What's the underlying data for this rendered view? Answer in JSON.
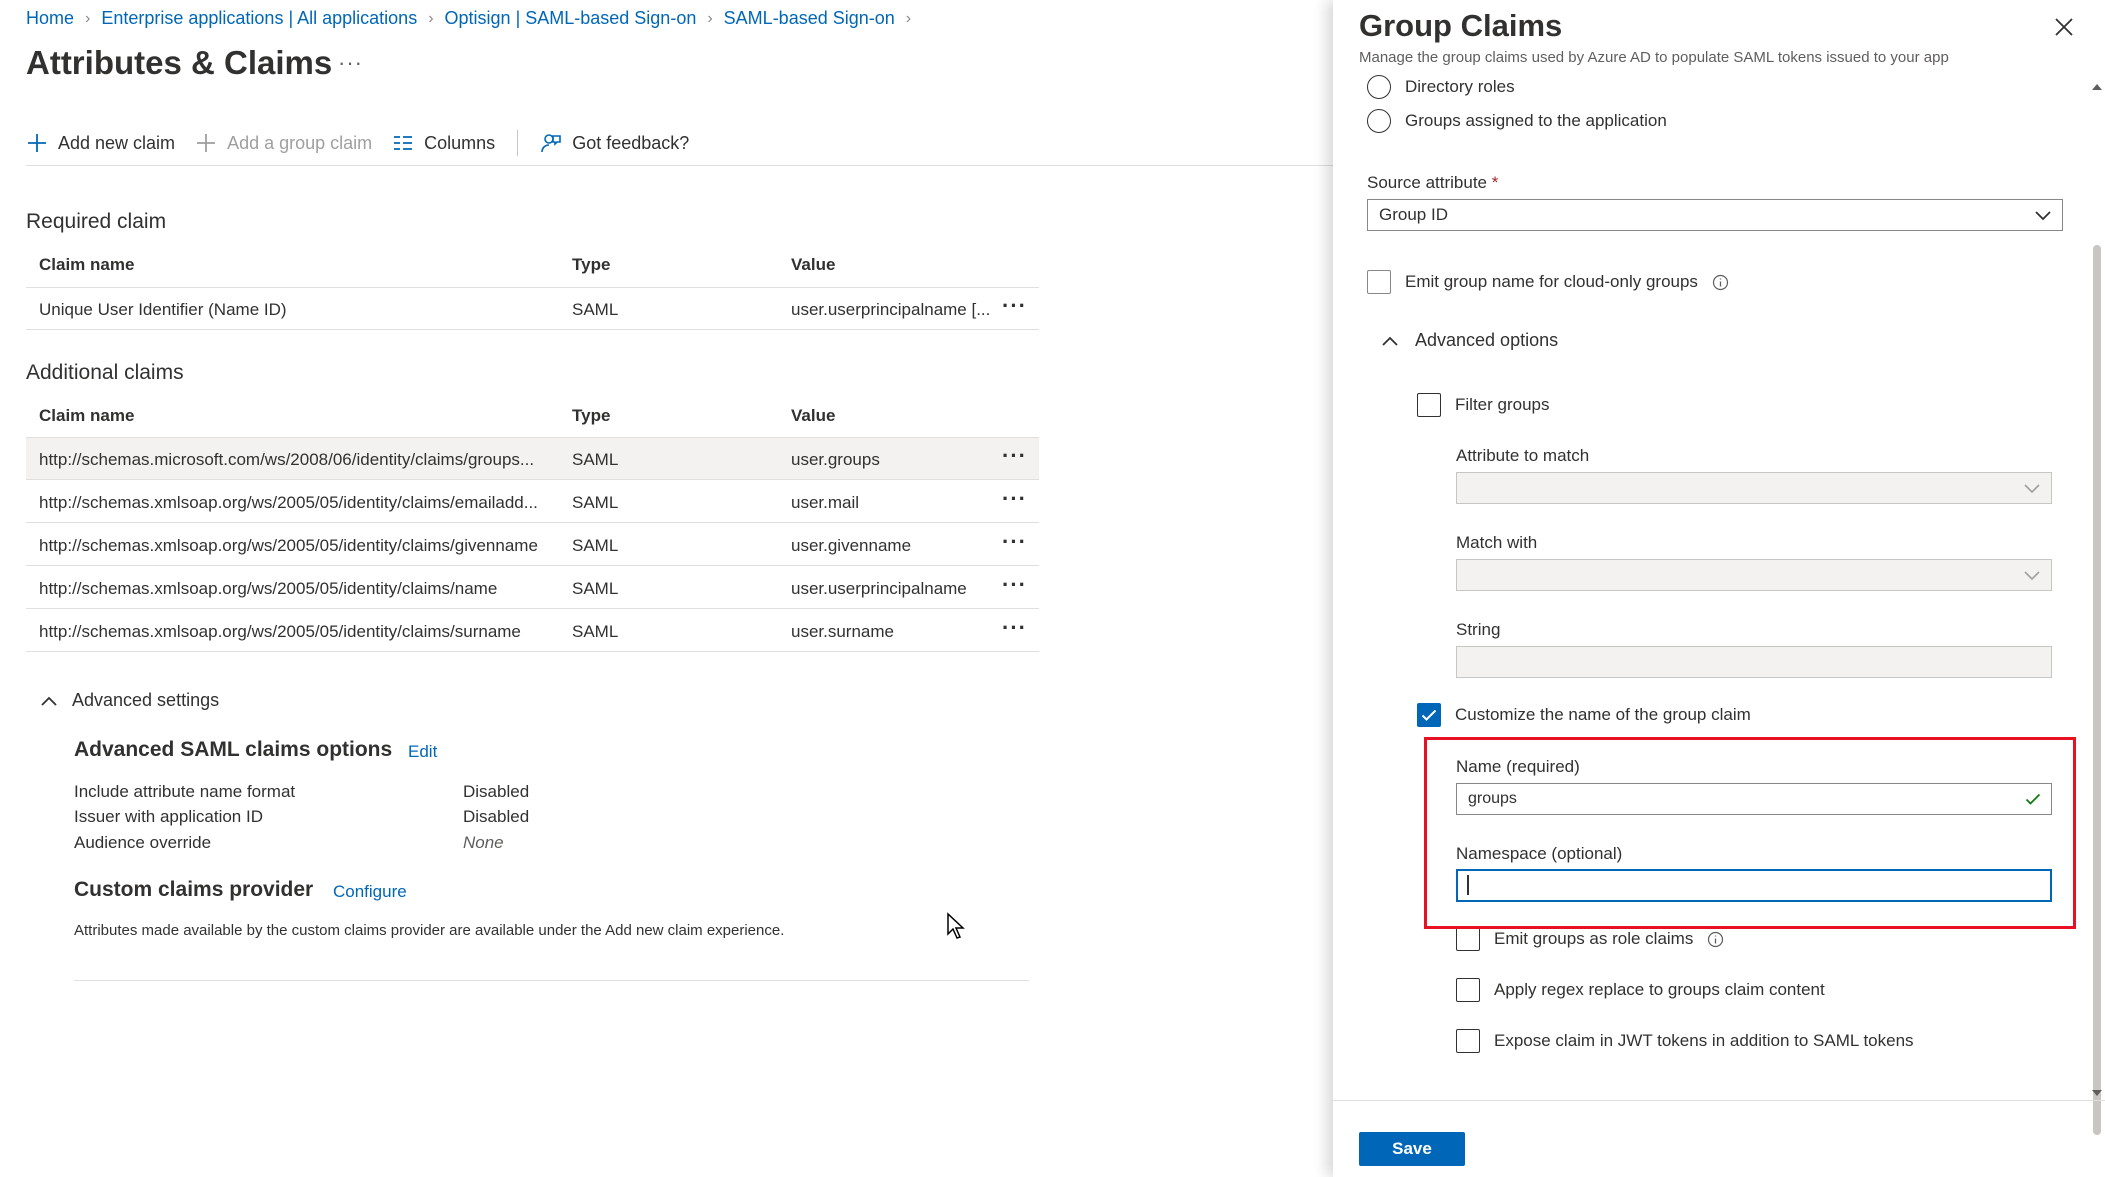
{
  "breadcrumb": {
    "items": [
      "Home",
      "Enterprise applications | All applications",
      "Optisign | SAML-based Sign-on",
      "SAML-based Sign-on"
    ],
    "separator": ">"
  },
  "page": {
    "title": "Attributes & Claims",
    "more": "···"
  },
  "toolbar": {
    "add_new_claim": "Add new claim",
    "add_group_claim": "Add a group claim",
    "columns": "Columns",
    "feedback": "Got feedback?"
  },
  "required": {
    "title": "Required claim",
    "headers": [
      "Claim name",
      "Type",
      "Value"
    ],
    "rows": [
      {
        "name": "Unique User Identifier (Name ID)",
        "type": "SAML",
        "value": "user.userprincipalname [..."
      }
    ]
  },
  "additional": {
    "title": "Additional claims",
    "headers": [
      "Claim name",
      "Type",
      "Value"
    ],
    "rows": [
      {
        "name": "http://schemas.microsoft.com/ws/2008/06/identity/claims/groups...",
        "type": "SAML",
        "value": "user.groups"
      },
      {
        "name": "http://schemas.xmlsoap.org/ws/2005/05/identity/claims/emailadd...",
        "type": "SAML",
        "value": "user.mail"
      },
      {
        "name": "http://schemas.xmlsoap.org/ws/2005/05/identity/claims/givenname",
        "type": "SAML",
        "value": "user.givenname"
      },
      {
        "name": "http://schemas.xmlsoap.org/ws/2005/05/identity/claims/name",
        "type": "SAML",
        "value": "user.userprincipalname"
      },
      {
        "name": "http://schemas.xmlsoap.org/ws/2005/05/identity/claims/surname",
        "type": "SAML",
        "value": "user.surname"
      }
    ],
    "more": "···"
  },
  "advanced": {
    "toggle": "Advanced settings",
    "saml_title": "Advanced SAML claims options",
    "edit": "Edit",
    "options": [
      {
        "label": "Include attribute name format",
        "value": "Disabled"
      },
      {
        "label": "Issuer with application ID",
        "value": "Disabled"
      },
      {
        "label": "Audience override",
        "value": "None"
      }
    ],
    "ccp_title": "Custom claims provider",
    "configure": "Configure",
    "note": "Attributes made available by the custom claims provider are available under the Add new claim experience."
  },
  "panel": {
    "title": "Group Claims",
    "subtitle": "Manage the group claims used by Azure AD to populate SAML tokens issued to your app",
    "radio_directory_roles": "Directory roles",
    "radio_groups_assigned": "Groups assigned to the application",
    "source_attribute_label": "Source attribute",
    "required_mark": "*",
    "source_attribute_value": "Group ID",
    "emit_cloud_only": "Emit group name for cloud-only groups",
    "advanced_options": "Advanced options",
    "filter_groups": "Filter groups",
    "attribute_to_match": "Attribute to match",
    "match_with": "Match with",
    "string": "String",
    "customize_name": "Customize the name of the group claim",
    "name_label": "Name (required)",
    "name_value": "groups",
    "namespace_label": "Namespace (optional)",
    "namespace_value": "",
    "emit_role_claims": "Emit groups as role claims",
    "apply_regex": "Apply regex replace to groups claim content",
    "expose_jwt": "Expose claim in JWT tokens in addition to SAML tokens",
    "save": "Save"
  },
  "colors": {
    "accent": "#0067b8",
    "highlight": "#e81123",
    "valid": "#107c10"
  }
}
